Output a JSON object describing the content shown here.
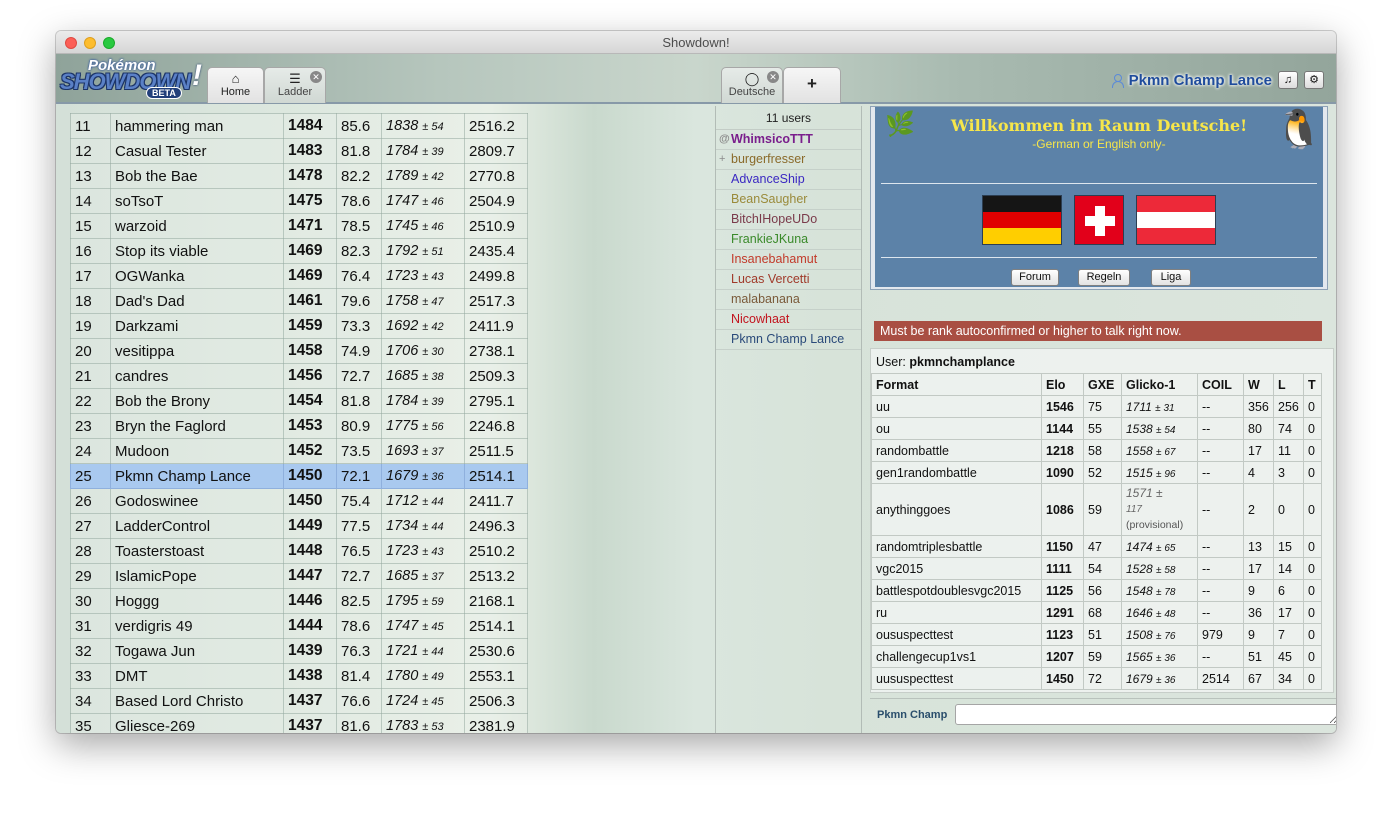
{
  "window": {
    "title": "Showdown!"
  },
  "header": {
    "logo": {
      "top": "Pokémon",
      "main": "SHOWDOWN",
      "badge": "BETA"
    },
    "tabs": [
      {
        "label": "Home",
        "icon": "home-icon"
      },
      {
        "label": "Ladder",
        "icon": "list-icon"
      },
      {
        "label": "Deutsche",
        "icon": "chat-bubble-icon"
      },
      {
        "label": "+",
        "icon": "plus-icon"
      }
    ],
    "username": "Pkmn Champ Lance"
  },
  "ladder": {
    "rows": [
      {
        "rank": "11",
        "name": "hammering man",
        "elo": "1484",
        "gxe": "85.6",
        "glicko": "1838",
        "dev": "54",
        "coil": "2516.2"
      },
      {
        "rank": "12",
        "name": "Casual Tester",
        "elo": "1483",
        "gxe": "81.8",
        "glicko": "1784",
        "dev": "39",
        "coil": "2809.7"
      },
      {
        "rank": "13",
        "name": "Bob the Bae",
        "elo": "1478",
        "gxe": "82.2",
        "glicko": "1789",
        "dev": "42",
        "coil": "2770.8"
      },
      {
        "rank": "14",
        "name": "soTsoT",
        "elo": "1475",
        "gxe": "78.6",
        "glicko": "1747",
        "dev": "46",
        "coil": "2504.9"
      },
      {
        "rank": "15",
        "name": "warzoid",
        "elo": "1471",
        "gxe": "78.5",
        "glicko": "1745",
        "dev": "46",
        "coil": "2510.9"
      },
      {
        "rank": "16",
        "name": "Stop its viable",
        "elo": "1469",
        "gxe": "82.3",
        "glicko": "1792",
        "dev": "51",
        "coil": "2435.4"
      },
      {
        "rank": "17",
        "name": "OGWanka",
        "elo": "1469",
        "gxe": "76.4",
        "glicko": "1723",
        "dev": "43",
        "coil": "2499.8"
      },
      {
        "rank": "18",
        "name": "Dad's Dad",
        "elo": "1461",
        "gxe": "79.6",
        "glicko": "1758",
        "dev": "47",
        "coil": "2517.3"
      },
      {
        "rank": "19",
        "name": "Darkzami",
        "elo": "1459",
        "gxe": "73.3",
        "glicko": "1692",
        "dev": "42",
        "coil": "2411.9"
      },
      {
        "rank": "20",
        "name": "vesitippa",
        "elo": "1458",
        "gxe": "74.9",
        "glicko": "1706",
        "dev": "30",
        "coil": "2738.1"
      },
      {
        "rank": "21",
        "name": "candres",
        "elo": "1456",
        "gxe": "72.7",
        "glicko": "1685",
        "dev": "38",
        "coil": "2509.3"
      },
      {
        "rank": "22",
        "name": "Bob the Brony",
        "elo": "1454",
        "gxe": "81.8",
        "glicko": "1784",
        "dev": "39",
        "coil": "2795.1"
      },
      {
        "rank": "23",
        "name": "Bryn the Faglord",
        "elo": "1453",
        "gxe": "80.9",
        "glicko": "1775",
        "dev": "56",
        "coil": "2246.8"
      },
      {
        "rank": "24",
        "name": "Mudoon",
        "elo": "1452",
        "gxe": "73.5",
        "glicko": "1693",
        "dev": "37",
        "coil": "2511.5"
      },
      {
        "rank": "25",
        "name": "Pkmn Champ Lance",
        "elo": "1450",
        "gxe": "72.1",
        "glicko": "1679",
        "dev": "36",
        "coil": "2514.1"
      },
      {
        "rank": "26",
        "name": "Godoswinee",
        "elo": "1450",
        "gxe": "75.4",
        "glicko": "1712",
        "dev": "44",
        "coil": "2411.7"
      },
      {
        "rank": "27",
        "name": "LadderControl",
        "elo": "1449",
        "gxe": "77.5",
        "glicko": "1734",
        "dev": "44",
        "coil": "2496.3"
      },
      {
        "rank": "28",
        "name": "Toasterstoast",
        "elo": "1448",
        "gxe": "76.5",
        "glicko": "1723",
        "dev": "43",
        "coil": "2510.2"
      },
      {
        "rank": "29",
        "name": "IslamicPope",
        "elo": "1447",
        "gxe": "72.7",
        "glicko": "1685",
        "dev": "37",
        "coil": "2513.2"
      },
      {
        "rank": "30",
        "name": "Hoggg",
        "elo": "1446",
        "gxe": "82.5",
        "glicko": "1795",
        "dev": "59",
        "coil": "2168.1"
      },
      {
        "rank": "31",
        "name": "verdigris 49",
        "elo": "1444",
        "gxe": "78.6",
        "glicko": "1747",
        "dev": "45",
        "coil": "2514.1"
      },
      {
        "rank": "32",
        "name": "Togawa Jun",
        "elo": "1439",
        "gxe": "76.3",
        "glicko": "1721",
        "dev": "44",
        "coil": "2530.6"
      },
      {
        "rank": "33",
        "name": "DMT",
        "elo": "1438",
        "gxe": "81.4",
        "glicko": "1780",
        "dev": "49",
        "coil": "2553.1"
      },
      {
        "rank": "34",
        "name": "Based Lord Christo",
        "elo": "1437",
        "gxe": "76.6",
        "glicko": "1724",
        "dev": "45",
        "coil": "2506.3"
      },
      {
        "rank": "35",
        "name": "Gliesce-269",
        "elo": "1437",
        "gxe": "81.6",
        "glicko": "1783",
        "dev": "53",
        "coil": "2381.9"
      }
    ],
    "highlight_color": "#a9c9ef"
  },
  "userlist": {
    "count": "11 users",
    "users": [
      {
        "group": "@",
        "name": "WhimsicoTTT",
        "color": "#7a1e8c",
        "bold": true
      },
      {
        "group": "+",
        "name": "burgerfresser",
        "color": "#8a6a2a",
        "bold": false
      },
      {
        "group": "",
        "name": "AdvanceShip",
        "color": "#3a28c2",
        "bold": false
      },
      {
        "group": "",
        "name": "BeanSaugher",
        "color": "#9a8a3a",
        "bold": false
      },
      {
        "group": "",
        "name": "BitchIHopeUDo",
        "color": "#7a3a4a",
        "bold": false
      },
      {
        "group": "",
        "name": "FrankieJKuna",
        "color": "#3a8a2a",
        "bold": false
      },
      {
        "group": "",
        "name": "Insanebahamut",
        "color": "#c23a2a",
        "bold": false
      },
      {
        "group": "",
        "name": "Lucas Vercetti",
        "color": "#a03a2a",
        "bold": false
      },
      {
        "group": "",
        "name": "malabanana",
        "color": "#7a5a3a",
        "bold": false
      },
      {
        "group": "",
        "name": "Nicowhaat",
        "color": "#c2141e",
        "bold": false
      },
      {
        "group": "",
        "name": "Pkmn Champ Lance",
        "color": "#2a4a7a",
        "bold": false
      }
    ]
  },
  "room": {
    "welcome": "Willkommen im Raum Deutsche!",
    "subtitle": "-German or English only-",
    "buttons": [
      "Forum",
      "Regeln",
      "Liga"
    ],
    "warning": "Must be rank autoconfirmed or higher to talk right now."
  },
  "userstats": {
    "label": "User:",
    "username": "pkmnchamplance",
    "headers": [
      "Format",
      "Elo",
      "GXE",
      "Glicko-1",
      "COIL",
      "W",
      "L",
      "T"
    ],
    "rows": [
      {
        "format": "uu",
        "elo": "1546",
        "gxe": "75",
        "glicko": "1711",
        "dev": "31",
        "prov": "",
        "coil": "--",
        "w": "356",
        "l": "256",
        "t": "0"
      },
      {
        "format": "ou",
        "elo": "1144",
        "gxe": "55",
        "glicko": "1538",
        "dev": "54",
        "prov": "",
        "coil": "--",
        "w": "80",
        "l": "74",
        "t": "0"
      },
      {
        "format": "randombattle",
        "elo": "1218",
        "gxe": "58",
        "glicko": "1558",
        "dev": "67",
        "prov": "",
        "coil": "--",
        "w": "17",
        "l": "11",
        "t": "0"
      },
      {
        "format": "gen1randombattle",
        "elo": "1090",
        "gxe": "52",
        "glicko": "1515",
        "dev": "96",
        "prov": "",
        "coil": "--",
        "w": "4",
        "l": "3",
        "t": "0"
      },
      {
        "format": "anythinggoes",
        "elo": "1086",
        "gxe": "59",
        "glicko": "1571",
        "dev": "117",
        "prov": "(provisional)",
        "coil": "--",
        "w": "2",
        "l": "0",
        "t": "0"
      },
      {
        "format": "randomtriplesbattle",
        "elo": "1150",
        "gxe": "47",
        "glicko": "1474",
        "dev": "65",
        "prov": "",
        "coil": "--",
        "w": "13",
        "l": "15",
        "t": "0"
      },
      {
        "format": "vgc2015",
        "elo": "1111",
        "gxe": "54",
        "glicko": "1528",
        "dev": "58",
        "prov": "",
        "coil": "--",
        "w": "17",
        "l": "14",
        "t": "0"
      },
      {
        "format": "battlespotdoublesvgc2015",
        "elo": "1125",
        "gxe": "56",
        "glicko": "1548",
        "dev": "78",
        "prov": "",
        "coil": "--",
        "w": "9",
        "l": "6",
        "t": "0"
      },
      {
        "format": "ru",
        "elo": "1291",
        "gxe": "68",
        "glicko": "1646",
        "dev": "48",
        "prov": "",
        "coil": "--",
        "w": "36",
        "l": "17",
        "t": "0"
      },
      {
        "format": "oususpecttest",
        "elo": "1123",
        "gxe": "51",
        "glicko": "1508",
        "dev": "76",
        "prov": "",
        "coil": "979",
        "w": "9",
        "l": "7",
        "t": "0"
      },
      {
        "format": "challengecup1vs1",
        "elo": "1207",
        "gxe": "59",
        "glicko": "1565",
        "dev": "36",
        "prov": "",
        "coil": "--",
        "w": "51",
        "l": "45",
        "t": "0"
      },
      {
        "format": "uususpecttest",
        "elo": "1450",
        "gxe": "72",
        "glicko": "1679",
        "dev": "36",
        "prov": "",
        "coil": "2514",
        "w": "67",
        "l": "34",
        "t": "0"
      }
    ]
  },
  "chat": {
    "name": "Pkmn Champ Lance",
    "placeholder": ""
  }
}
